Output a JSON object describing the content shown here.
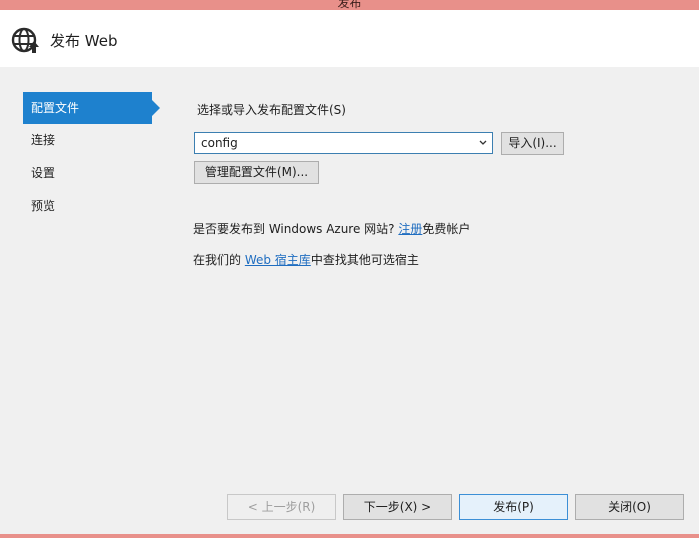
{
  "window": {
    "title": "发布 Web",
    "titlebar_text": "发布"
  },
  "header": {
    "title": "发布 Web",
    "icon": "globe-publish-icon"
  },
  "sidebar": {
    "items": [
      {
        "label": "配置文件",
        "active": true
      },
      {
        "label": "连接",
        "active": false
      },
      {
        "label": "设置",
        "active": false
      },
      {
        "label": "预览",
        "active": false
      }
    ]
  },
  "profile": {
    "select_label": "选择或导入发布配置文件(S)",
    "selected_profile": "config",
    "import_button": "导入(I)...",
    "manage_button": "管理配置文件(M)..."
  },
  "azure": {
    "prefix": "是否要发布到 Windows Azure 网站? ",
    "link": "注册",
    "suffix": "免费帐户"
  },
  "hosting": {
    "prefix": "在我们的 ",
    "link": "Web 宿主库",
    "suffix": "中查找其他可选宿主"
  },
  "footer": {
    "prev_button": "< 上一步(R)",
    "next_button": "下一步(X) >",
    "publish_button": "发布(P)",
    "close_button": "关闭(O)"
  },
  "colors": {
    "accent": "#1e81ce",
    "titlebar": "#e8908a",
    "link": "#1f6dc0"
  }
}
